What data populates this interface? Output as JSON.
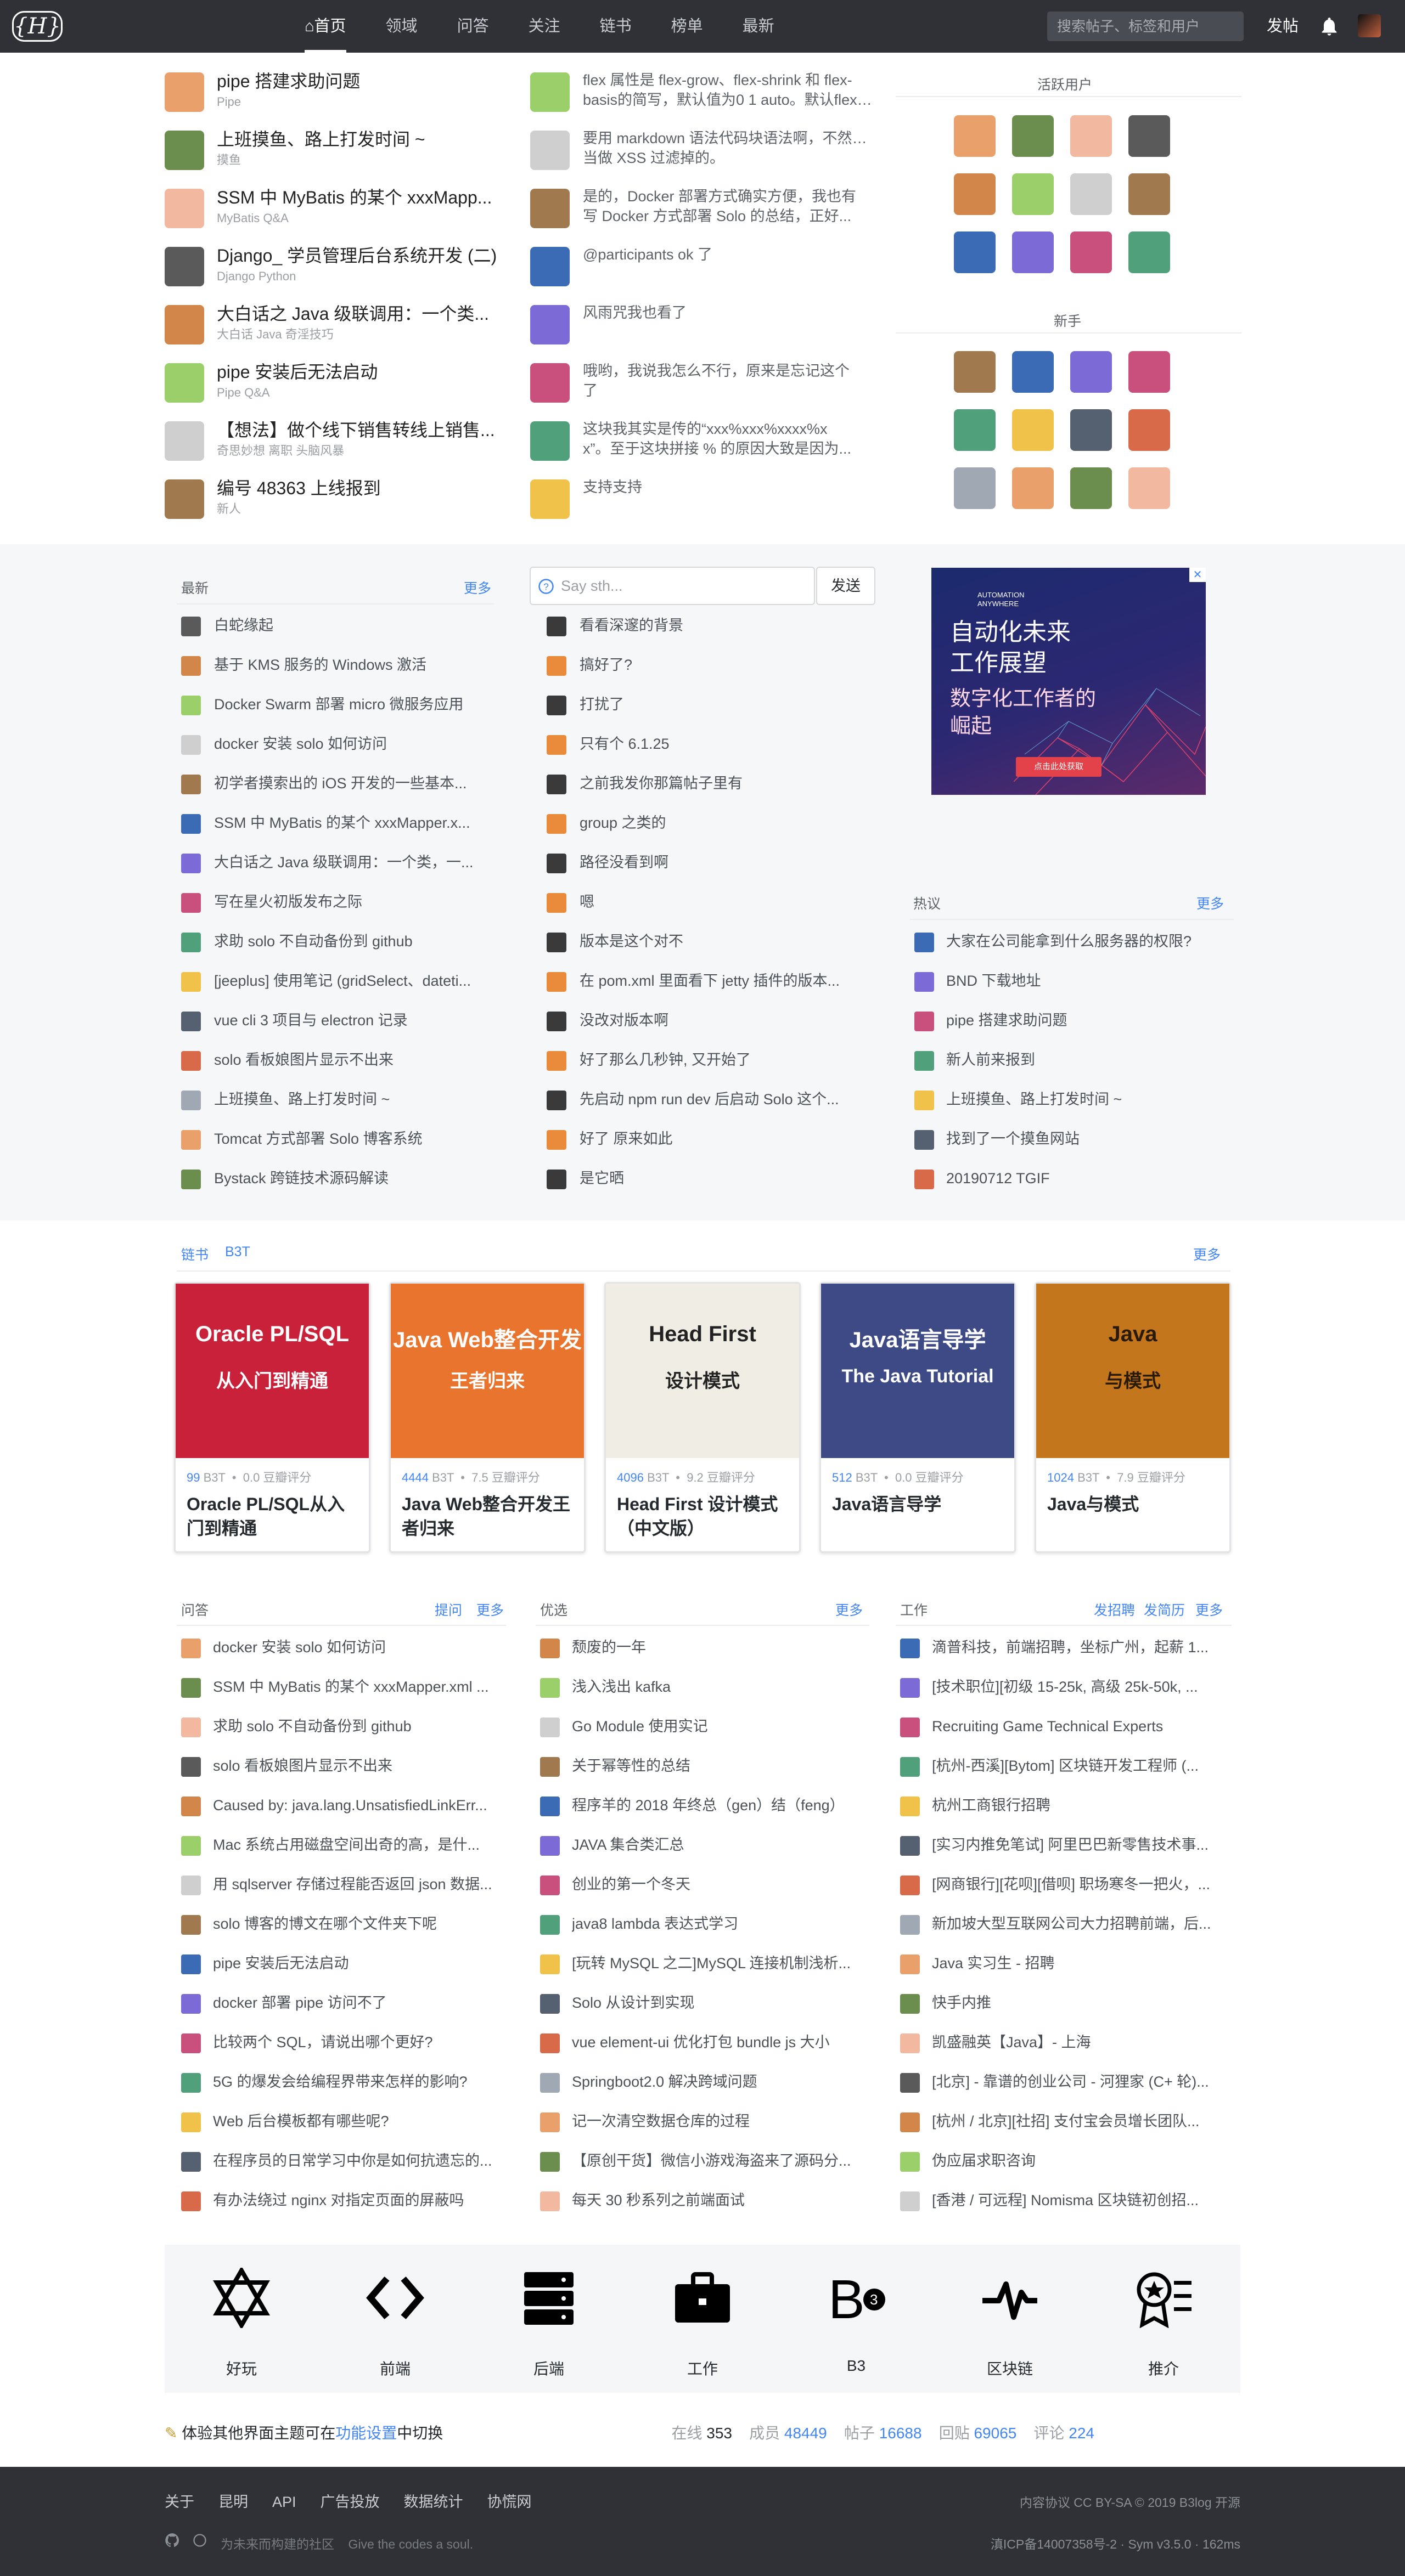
{
  "nav": {
    "items": [
      "首页",
      "领域",
      "问答",
      "关注",
      "链书",
      "榜单",
      "最新"
    ],
    "search_placeholder": "搜索帖子、标签和用户",
    "post": "发帖"
  },
  "top_posts": [
    {
      "title": "pipe 搭建求助问题",
      "tags": "Pipe"
    },
    {
      "title": "上班摸鱼、路上打发时间 ~",
      "tags": "摸鱼"
    },
    {
      "title": "SSM 中 MyBatis 的某个 xxxMapp...",
      "tags": "MyBatis    Q&A"
    },
    {
      "title": "Django_ 学员管理后台系统开发 (二)",
      "tags": "Django    Python"
    },
    {
      "title": "大白话之 Java 级联调用：一个类...",
      "tags": "大白话    Java    奇淫技巧"
    },
    {
      "title": "pipe 安装后无法启动",
      "tags": "Pipe    Q&A"
    },
    {
      "title": "【想法】做个线下销售转线上销售...",
      "tags": "奇思妙想    离职    头脑风暴"
    },
    {
      "title": "编号 48363 上线报到",
      "tags": "新人"
    }
  ],
  "comments": [
    [
      "flex 属性是 flex-grow、flex-shrink 和 flex-",
      "basis的简写，默认值为0 1 auto。默认flex-g..."
    ],
    [
      "要用 markdown 语法代码块语法啊，不然会被",
      "当做 XSS 过滤掉的。"
    ],
    [
      "是的，Docker 部署方式确实方便，我也有",
      "写 Docker 方式部署 Solo 的总结，正好..."
    ],
    [
      "@participants ok 了"
    ],
    [
      "风雨咒我也看了"
    ],
    [
      "哦哟，我说我怎么不行，原来是忘记这个",
      "了"
    ],
    [
      "这块我其实是传的“xxx%xxx%xxxx%x",
      "x”。至于这块拼接 % 的原因大致是因为..."
    ],
    [
      "支持支持"
    ]
  ],
  "active_users_title": "活跃用户",
  "new_users_title": "新手",
  "latest": {
    "title": "最新",
    "more": "更多",
    "items": [
      "白蛇缘起",
      "基于 KMS 服务的 Windows 激活",
      "Docker Swarm 部署 micro 微服务应用",
      "docker 安装 solo 如何访问",
      "初学者摸索出的 iOS 开发的一些基本...",
      "SSM 中 MyBatis 的某个 xxxMapper.x...",
      "大白话之 Java 级联调用：一个类，一...",
      "写在星火初版发布之际",
      "求助 solo 不自动备份到 github",
      "[jeeplus] 使用笔记 (gridSelect、dateti...",
      "vue cli 3 项目与 electron 记录",
      "solo 看板娘图片显示不出来",
      "上班摸鱼、路上打发时间 ~",
      "Tomcat 方式部署 Solo 博客系统",
      "Bystack 跨链技术源码解读"
    ]
  },
  "chat": {
    "placeholder": "Say sth...",
    "send": "发送",
    "items": [
      "看看深邃的背景",
      "搞好了?",
      "打扰了",
      "只有个 6.1.25",
      "之前我发你那篇帖子里有",
      "group 之类的",
      "路径没看到啊",
      "嗯",
      "版本是这个对不",
      "在 pom.xml 里面看下 jetty 插件的版本...",
      "没改对版本啊",
      "好了那么几秒钟, 又开始了",
      "先启动 npm run dev 后启动 Solo 这个...",
      "好了 原来如此",
      "是它晒"
    ]
  },
  "ad": {
    "brand": "AUTOMATION ANYWHERE",
    "line1": "自动化未来",
    "line2": "工作展望",
    "line3": "数字化工作者的",
    "line4": "崛起",
    "cta": "点击此处获取"
  },
  "hot": {
    "title": "热议",
    "more": "更多",
    "items": [
      "大家在公司能拿到什么服务器的权限?",
      "BND 下载地址",
      "pipe 搭建求助问题",
      "新人前来报到",
      "上班摸鱼、路上打发时间 ~",
      "找到了一个摸鱼网站",
      "20190712 TGIF"
    ]
  },
  "books": {
    "tab1": "链书",
    "tab2": "B3T",
    "more": "更多",
    "items": [
      {
        "b3t": "99",
        "unit": "B3T",
        "score": "0.0 豆瓣评分",
        "title": "Oracle PL/SQL从入门到精通",
        "cover_t1": "Oracle PL/SQL",
        "cover_t2": "从入门到精通"
      },
      {
        "b3t": "4444",
        "unit": "B3T",
        "score": "7.5 豆瓣评分",
        "title": "Java Web整合开发王者归来",
        "cover_t1": "Java Web整合开发",
        "cover_t2": "王者归来"
      },
      {
        "b3t": "4096",
        "unit": "B3T",
        "score": "9.2 豆瓣评分",
        "title": "Head First 设计模式（中文版）",
        "cover_t1": "Head First",
        "cover_t2": "设计模式"
      },
      {
        "b3t": "512",
        "unit": "B3T",
        "score": "0.0 豆瓣评分",
        "title": "Java语言导学",
        "cover_t1": "Java语言导学",
        "cover_t2": "The Java Tutorial"
      },
      {
        "b3t": "1024",
        "unit": "B3T",
        "score": "7.9 豆瓣评分",
        "title": "Java与模式",
        "cover_t1": "Java",
        "cover_t2": "与模式"
      }
    ]
  },
  "qa": {
    "title": "问答",
    "ask": "提问",
    "more": "更多",
    "items": [
      "docker 安装 solo 如何访问",
      "SSM 中 MyBatis 的某个 xxxMapper.xml ...",
      "求助 solo 不自动备份到 github",
      "solo 看板娘图片显示不出来",
      "Caused by: java.lang.UnsatisfiedLinkErr...",
      "Mac 系统占用磁盘空间出奇的高，是什...",
      "用 sqlserver 存储过程能否返回 json 数据...",
      "solo 博客的博文在哪个文件夹下呢",
      "pipe 安装后无法启动",
      "docker 部署 pipe 访问不了",
      "比较两个 SQL，请说出哪个更好?",
      "5G 的爆发会给编程界带来怎样的影响?",
      "Web 后台模板都有哪些呢?",
      "在程序员的日常学习中你是如何抗遗忘的...",
      "有办法绕过 nginx 对指定页面的屏蔽吗"
    ]
  },
  "picks": {
    "title": "优选",
    "more": "更多",
    "items": [
      "颓废的一年",
      "浅入浅出 kafka",
      "Go Module 使用实记",
      "关于幂等性的总结",
      "程序羊的 2018 年终总（gen）结（feng）",
      "JAVA 集合类汇总",
      "创业的第一个冬天",
      "java8 lambda 表达式学习",
      "[玩转 MySQL 之二]MySQL 连接机制浅析...",
      "Solo 从设计到实现",
      "vue element-ui 优化打包 bundle js 大小",
      "Springboot2.0 解决跨域问题",
      "记一次清空数据仓库的过程",
      "【原创干货】微信小游戏海盗来了源码分...",
      "每天 30 秒系列之前端面试"
    ]
  },
  "jobs": {
    "title": "工作",
    "post_job": "发招聘",
    "post_resume": "发简历",
    "more": "更多",
    "items": [
      "滴普科技，前端招聘，坐标广州，起薪 1...",
      "[技术职位][初级 15-25k, 高级 25k-50k, ...",
      "Recruiting Game Technical Experts",
      "[杭州-西溪][Bytom] 区块链开发工程师 (...",
      "杭州工商银行招聘",
      "[实习内推免笔试] 阿里巴巴新零售技术事...",
      "[网商银行][花呗][借呗] 职场寒冬一把火，...",
      "新加坡大型互联网公司大力招聘前端，后...",
      "Java 实习生 - 招聘",
      "快手内推",
      "凯盛融英【Java】- 上海",
      "[北京] - 靠谱的创业公司 - 河狸家 (C+ 轮)...",
      "[杭州 / 北京][社招] 支付宝会员增长团队...",
      "伪应届求职咨询",
      "[香港 / 可远程] Nomisma 区块链初创招..."
    ]
  },
  "domains": [
    "好玩",
    "前端",
    "后端",
    "工作",
    "B3",
    "区块链",
    "推介"
  ],
  "theme_tip": {
    "pre": "体验其他界面主题可在",
    "link": "功能设置",
    "post": "中切换"
  },
  "stats": {
    "online_label": "在线",
    "online": "353",
    "members_label": "成员",
    "members": "48449",
    "posts_label": "帖子",
    "posts": "16688",
    "replies_label": "回贴",
    "replies": "69065",
    "comments_label": "评论",
    "comments": "224"
  },
  "footer": {
    "links": [
      "关于",
      "昆明",
      "API",
      "广告投放",
      "数据统计",
      "协慌网"
    ],
    "license": "内容协议 CC BY-SA © 2019 B3log 开源",
    "slogan": "为未来而构建的社区    Give the codes a soul.",
    "icp": "滇ICP备14007358号-2 · Sym v3.5.0 · 162ms"
  },
  "colors": {
    "nav": "#2f3136",
    "link": "#4285f4",
    "text": "#24292e",
    "muted": "#9b9ea3"
  }
}
